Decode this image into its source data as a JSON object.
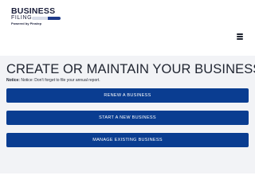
{
  "header": {
    "logo": {
      "line1": "BUSINESS",
      "line2": "FILING",
      "tagline": "Powered by Pinstep"
    },
    "menu_icon": "hamburger-menu-icon"
  },
  "main": {
    "title": "CREATE OR MAINTAIN YOUR BUSINESS",
    "notice_label": "Notice:",
    "notice_text": "Notice: Don't forget to file your annual report.",
    "buttons": {
      "renew": "RENEW A BUSINESS",
      "start": "START A NEW BUSINESS",
      "manage": "MANAGE EXISTING BUSINESS"
    }
  },
  "colors": {
    "button": "#0a3d91",
    "page_background": "#f2f3f6",
    "header_background": "#ffffff",
    "text": "#1f2430"
  }
}
